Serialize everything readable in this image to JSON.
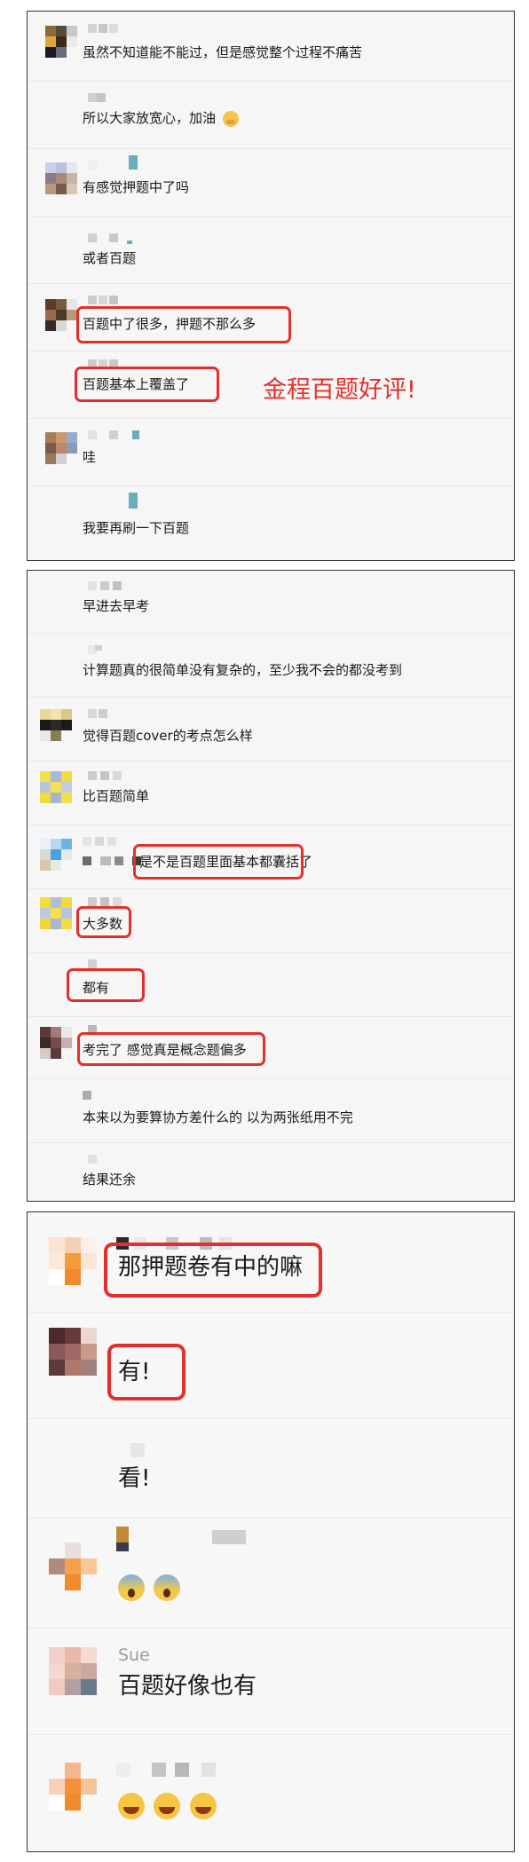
{
  "panel1": {
    "messages": [
      {
        "text": "虽然不知道能不能过，但是感觉整个过程不痛苦"
      },
      {
        "text": "所以大家放宽心，加油"
      },
      {
        "text": "有感觉押题中了吗"
      },
      {
        "text": "或者百题"
      },
      {
        "text": "百题中了很多，押题不那么多"
      },
      {
        "text": "百题基本上覆盖了"
      },
      {
        "text": "哇"
      },
      {
        "text": "我要再刷一下百题"
      }
    ],
    "annotation": "金程百题好评!"
  },
  "panel2": {
    "messages": [
      {
        "text": "早进去早考"
      },
      {
        "text": "计算题真的很简单没有复杂的，至少我不会的都没考到"
      },
      {
        "text": "觉得百题cover的考点怎么样"
      },
      {
        "text": "比百题简单"
      },
      {
        "text": "是不是百题里面基本都囊括了"
      },
      {
        "text": "大多数"
      },
      {
        "text": "都有"
      },
      {
        "text": "考完了 感觉真是概念题偏多"
      },
      {
        "text": "本来以为要算协方差什么的 以为两张纸用不完"
      },
      {
        "text": "结果还余"
      }
    ]
  },
  "panel3": {
    "messages": [
      {
        "text": "那押题卷有中的嘛"
      },
      {
        "text": "有!"
      },
      {
        "text": "看!"
      },
      {
        "text": ""
      },
      {
        "sender": "Sue",
        "text": "百题好像也有"
      },
      {
        "text": ""
      }
    ]
  },
  "colors": {
    "highlight": "#e3302b",
    "panel_bg": "#f6f6f7"
  },
  "icons": [
    "mouth-covered-face-emoji",
    "screaming-face-emoji",
    "grinning-squinting-face-emoji"
  ]
}
